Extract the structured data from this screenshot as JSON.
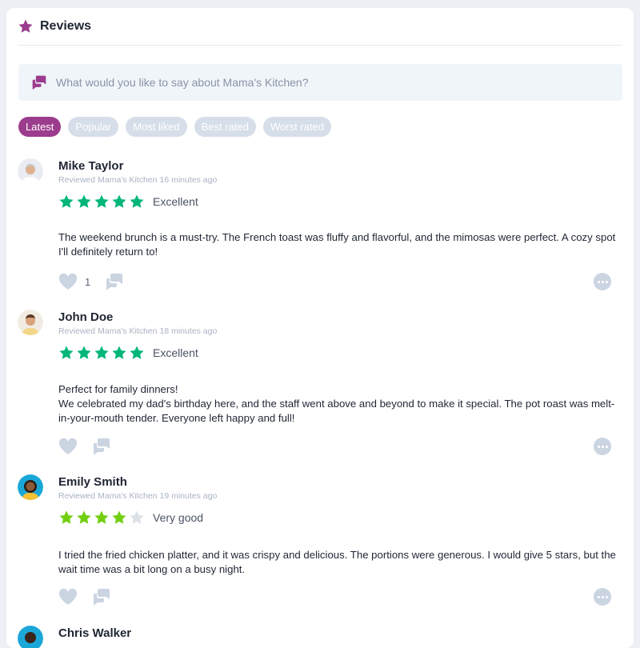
{
  "header": {
    "title": "Reviews",
    "icon": "star-icon",
    "accent": "#9c3c8d"
  },
  "composer": {
    "placeholder": "What would you like to say about Mama's Kitchen?",
    "icon": "chat-bubbles-icon"
  },
  "tabs": [
    {
      "label": "Latest",
      "active": true
    },
    {
      "label": "Popular",
      "active": false
    },
    {
      "label": "Most liked",
      "active": false
    },
    {
      "label": "Best rated",
      "active": false
    },
    {
      "label": "Worst rated",
      "active": false
    }
  ],
  "reviews": [
    {
      "name": "Mike Taylor",
      "reviewed_prefix": "Reviewed",
      "place": "Mama's Kitchen",
      "time": "16 minutes ago",
      "rating": 5,
      "rating_label": "Excellent",
      "body": [
        "The weekend brunch is a must-try. The French toast was fluffy and flavorful, and the mimosas were perfect. A cozy spot I'll definitely return to!"
      ],
      "likes": "1"
    },
    {
      "name": "John Doe",
      "reviewed_prefix": "Reviewed",
      "place": "Mama's Kitchen",
      "time": "18 minutes ago",
      "rating": 5,
      "rating_label": "Excellent",
      "body": [
        "Perfect for family dinners!",
        "We celebrated my dad's birthday here, and the staff went above and beyond to make it special. The pot roast was melt-in-your-mouth tender. Everyone left happy and full!"
      ],
      "likes": ""
    },
    {
      "name": "Emily Smith",
      "reviewed_prefix": "Reviewed",
      "place": "Mama's Kitchen",
      "time": "19 minutes ago",
      "rating": 4,
      "rating_label": "Very good",
      "body": [
        "I tried the fried chicken platter, and it was crispy and delicious. The portions were generous. I would give 5 stars, but the wait time was a bit long on a busy night."
      ],
      "likes": ""
    },
    {
      "name": "Chris Walker"
    }
  ],
  "colors": {
    "star_5": "#00b67a",
    "star_4": "#73cf11",
    "star_empty": "#dce1e8",
    "icon_muted": "#cbd4e1"
  }
}
